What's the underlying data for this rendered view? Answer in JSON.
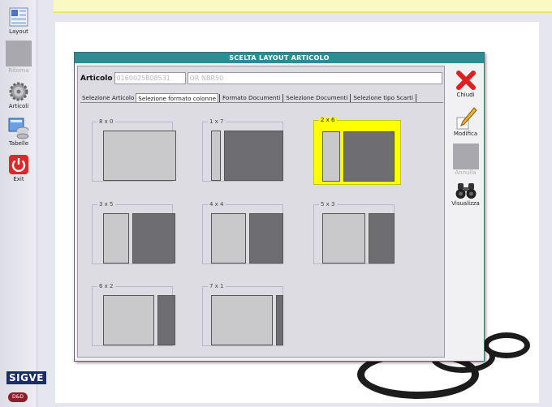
{
  "left_bar": {
    "items": [
      {
        "label": "Layout",
        "icon": "layout-icon",
        "enabled": true
      },
      {
        "label": "Ritorna",
        "icon": "return-icon",
        "enabled": false
      },
      {
        "label": "Articoli",
        "icon": "gear-icon",
        "enabled": true
      },
      {
        "label": "Tabelle",
        "icon": "database-icon",
        "enabled": true
      },
      {
        "label": "Exit",
        "icon": "power-icon",
        "enabled": true
      }
    ],
    "logo_top": "SIGVE",
    "logo_bottom": "D&D"
  },
  "dialog": {
    "title": "SCELTA LAYOUT ARTICOLO",
    "articolo_label": "Articolo",
    "articolo_code": "0160025808531",
    "articolo_desc": "OR NBR50",
    "tabs": [
      {
        "label": "Selezione Articolo",
        "active": false
      },
      {
        "label": "Selezione formato colonne",
        "active": true
      },
      {
        "label": "Formato Documenti",
        "active": false
      },
      {
        "label": "Selezione Documenti",
        "active": false
      },
      {
        "label": "Selezione tipo Scarti",
        "active": false
      }
    ],
    "layouts": [
      {
        "label": "8 x 0",
        "selected": false
      },
      {
        "label": "1 x 7",
        "selected": false
      },
      {
        "label": "2 x 6",
        "selected": true
      },
      {
        "label": "3 x 5",
        "selected": false
      },
      {
        "label": "4 x 4",
        "selected": false
      },
      {
        "label": "5 x 3",
        "selected": false
      },
      {
        "label": "6 x 2",
        "selected": false
      },
      {
        "label": "7 x 1",
        "selected": false
      }
    ],
    "side_buttons": [
      {
        "label": "Chiudi",
        "icon": "close-icon",
        "enabled": true
      },
      {
        "label": "Modifica",
        "icon": "pencil-icon",
        "enabled": true
      },
      {
        "label": "Annulla",
        "icon": "cancel-icon",
        "enabled": false
      },
      {
        "label": "Visualizza",
        "icon": "binoculars-icon",
        "enabled": true
      }
    ]
  },
  "colors": {
    "title_bar": "#2e8b92",
    "selected_layout": "#ffff00",
    "close_red": "#e02020"
  }
}
